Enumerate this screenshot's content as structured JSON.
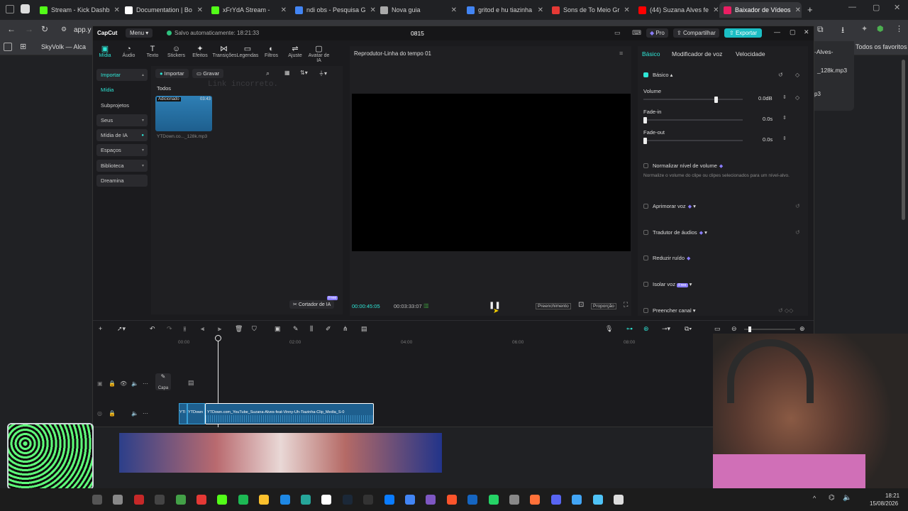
{
  "browser": {
    "tabs": [
      {
        "label": "Stream - Kick Dashb",
        "color": "#53fc18"
      },
      {
        "label": "Documentation | Bo",
        "color": "#ffffff"
      },
      {
        "label": "xFrYdA Stream -",
        "color": "#53fc18"
      },
      {
        "label": "ndi obs - Pesquisa G",
        "color": "#4285f4"
      },
      {
        "label": "Nova guia",
        "color": "#aaaaaa"
      },
      {
        "label": "gritod e hu tiazinha",
        "color": "#4285f4"
      },
      {
        "label": "Sons de To Meio Gr",
        "color": "#e53935"
      },
      {
        "label": "(44) Suzana Alves fe",
        "color": "#ff0000"
      },
      {
        "label": "Baixador de Vídeos",
        "color": "#e91e63"
      }
    ],
    "address": "app.y",
    "bookmark": "SkyVolk — Alca",
    "all_bookmarks": "Todos os favoritos",
    "side_popup_line1": "-Alves-",
    "side_popup_line2": "_128k.mp3",
    "side_popup_line3": "p3"
  },
  "capcut": {
    "logo": "CapCut",
    "menu": "Menu",
    "autosave": "Salvo automaticamente: 18:21:33",
    "project": "0815",
    "pro": "Pro",
    "share": "Compartilhar",
    "export": "Exportar",
    "toolbar": [
      "Mídia",
      "Áudio",
      "Texto",
      "Stickers",
      "Efeitos",
      "Transições",
      "Legendas",
      "Filtros",
      "Ajuste",
      "Avatar de IA"
    ],
    "sidebar": [
      "Importar",
      "Mídia",
      "Subprojetos",
      "Seus",
      "Mídia de IA",
      "Espaços",
      "Biblioteca",
      "Dreamina"
    ],
    "media": {
      "import": "Importar",
      "record": "Gravar",
      "all": "Todos",
      "overlay_text": "Link incorreto.",
      "clip_added": "Adicionado",
      "clip_duration": "03:43",
      "clip_name": "YTDown.co..._128k.mp3",
      "ai_cutter": "Cortador de IA",
      "free": "Free"
    },
    "player": {
      "title": "Reprodutor-Linha do tempo 01",
      "current_time": "00:00:45:05",
      "total_time": "00:03:33:07",
      "fill": "Preenchimento",
      "ratio": "Proporção"
    },
    "right": {
      "tabs": [
        "Básico",
        "Modificador de voz",
        "Velocidade"
      ],
      "basic": "Básico",
      "volume_label": "Volume",
      "volume_value": "0.0dB",
      "volume_level": 0.73,
      "fadein_label": "Fade-in",
      "fadein_value": "0.0s",
      "fadeout_label": "Fade-out",
      "fadeout_value": "0.0s",
      "normalize": "Normalizar nível de volume",
      "normalize_desc": "Normalize o volume do clipe ou clipes selecionados para um nível-alvo.",
      "enhance": "Aprimorar voz",
      "translator": "Tradutor de áudios",
      "noise": "Reduzir ruído",
      "isolate": "Isolar voz",
      "isolate_badge": "Free",
      "fill_channel": "Preencher canal"
    },
    "timeline": {
      "ticks": [
        "00:00",
        "02:00",
        "04:00",
        "06:00",
        "08:00",
        "10:00"
      ],
      "cover": "Capa",
      "clip_a": "YTI",
      "clip_b": "YTDown",
      "clip_main": "YTDown.com_YouTube_Suzana-Alves-feat-Vinny-Uh-Tiazinha-Clip_Media_S-0"
    }
  },
  "taskbar": {
    "time": "18:21",
    "date": "15/08/2026"
  }
}
